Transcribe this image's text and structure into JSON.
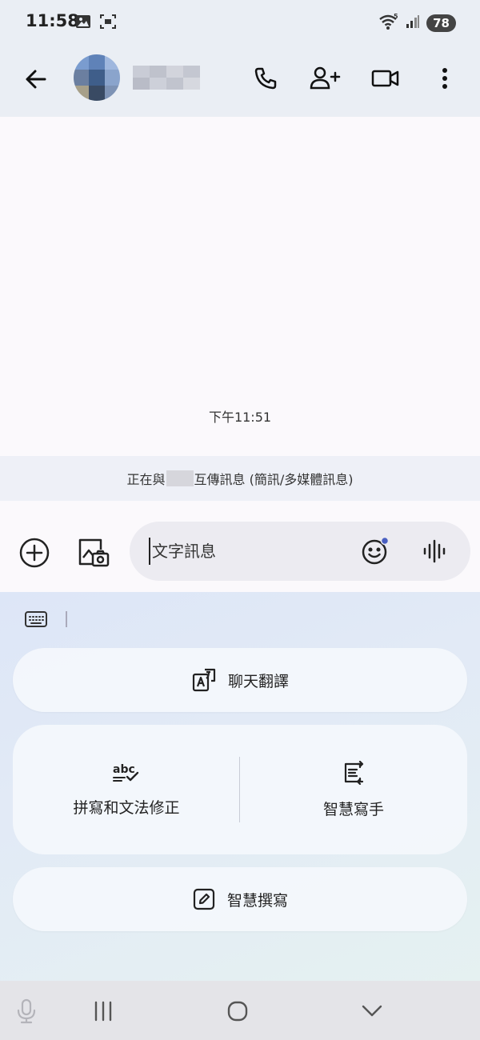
{
  "status_bar": {
    "time": "11:58",
    "battery": "78",
    "icons": [
      "image-icon",
      "screenshot-icon",
      "wifi-5-icon",
      "signal-icon"
    ]
  },
  "app_bar": {
    "icons": [
      "back-arrow-icon",
      "phone-icon",
      "add-person-icon",
      "video-camera-icon",
      "more-vert-icon"
    ]
  },
  "conversation": {
    "timestamp": "下午11:51"
  },
  "banner": {
    "prefix": "正在與",
    "suffix": "互傳訊息 (簡訊/多媒體訊息)"
  },
  "compose": {
    "placeholder": "文字訊息",
    "icons": [
      "add-circle-icon",
      "gallery-camera-icon",
      "emoji-icon",
      "voice-wave-icon"
    ]
  },
  "keyboard_panel": {
    "chat_translate": "聊天翻譯",
    "spell_grammar": "拼寫和文法修正",
    "smart_writer": "智慧寫手",
    "smart_compose": "智慧撰寫"
  },
  "nav": {
    "icons": [
      "microphone-icon",
      "recent-apps-icon",
      "home-icon",
      "hide-keyboard-icon"
    ]
  },
  "colors": {
    "accent_dot": "#4a5fc1",
    "app_bar_bg": "#eaeef4",
    "panel_gradient_start": "#dde6f7",
    "panel_gradient_end": "#e5f1f1"
  }
}
